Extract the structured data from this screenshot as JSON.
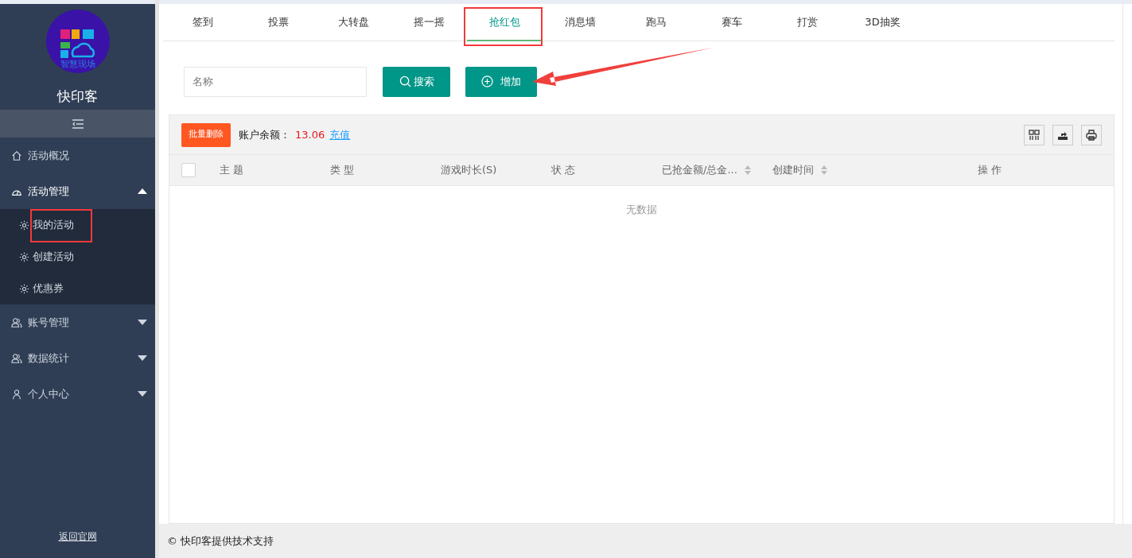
{
  "sidebar": {
    "logo_text": "智慧现场",
    "brand": "快印客",
    "items": [
      {
        "label": "活动概况"
      },
      {
        "label": "活动管理",
        "expanded": true,
        "children": [
          {
            "label": "我的活动"
          },
          {
            "label": "创建活动"
          },
          {
            "label": "优惠券"
          }
        ]
      },
      {
        "label": "账号管理",
        "expanded": false
      },
      {
        "label": "数据统计",
        "expanded": false
      },
      {
        "label": "个人中心",
        "expanded": false
      }
    ],
    "footer_link": "返回官网"
  },
  "tabs": [
    {
      "label": "签到",
      "selected": false
    },
    {
      "label": "投票",
      "selected": false
    },
    {
      "label": "大转盘",
      "selected": false
    },
    {
      "label": "摇一摇",
      "selected": false
    },
    {
      "label": "抢红包",
      "selected": true
    },
    {
      "label": "消息墙",
      "selected": false
    },
    {
      "label": "跑马",
      "selected": false
    },
    {
      "label": "赛车",
      "selected": false
    },
    {
      "label": "打赏",
      "selected": false
    },
    {
      "label": "3D抽奖",
      "selected": false
    }
  ],
  "search": {
    "placeholder": "名称",
    "search_button": "搜索",
    "add_button": "增加"
  },
  "toolbar": {
    "batch_delete": "批量删除",
    "balance_label": "账户余额：",
    "balance": "13.06",
    "recharge": "充值"
  },
  "table": {
    "select_all_checked": false,
    "columns": [
      {
        "label": "主 题",
        "sortable": false
      },
      {
        "label": "类 型",
        "sortable": false
      },
      {
        "label": "游戏时长(S)",
        "sortable": false
      },
      {
        "label": "状 态",
        "sortable": false
      },
      {
        "label": "已抢金额/总金...",
        "sortable": true
      },
      {
        "label": "创建时间",
        "sortable": true
      },
      {
        "label": "操 作",
        "sortable": false
      }
    ],
    "empty_text": "无数据"
  },
  "footer": "© 快印客提供技术支持"
}
